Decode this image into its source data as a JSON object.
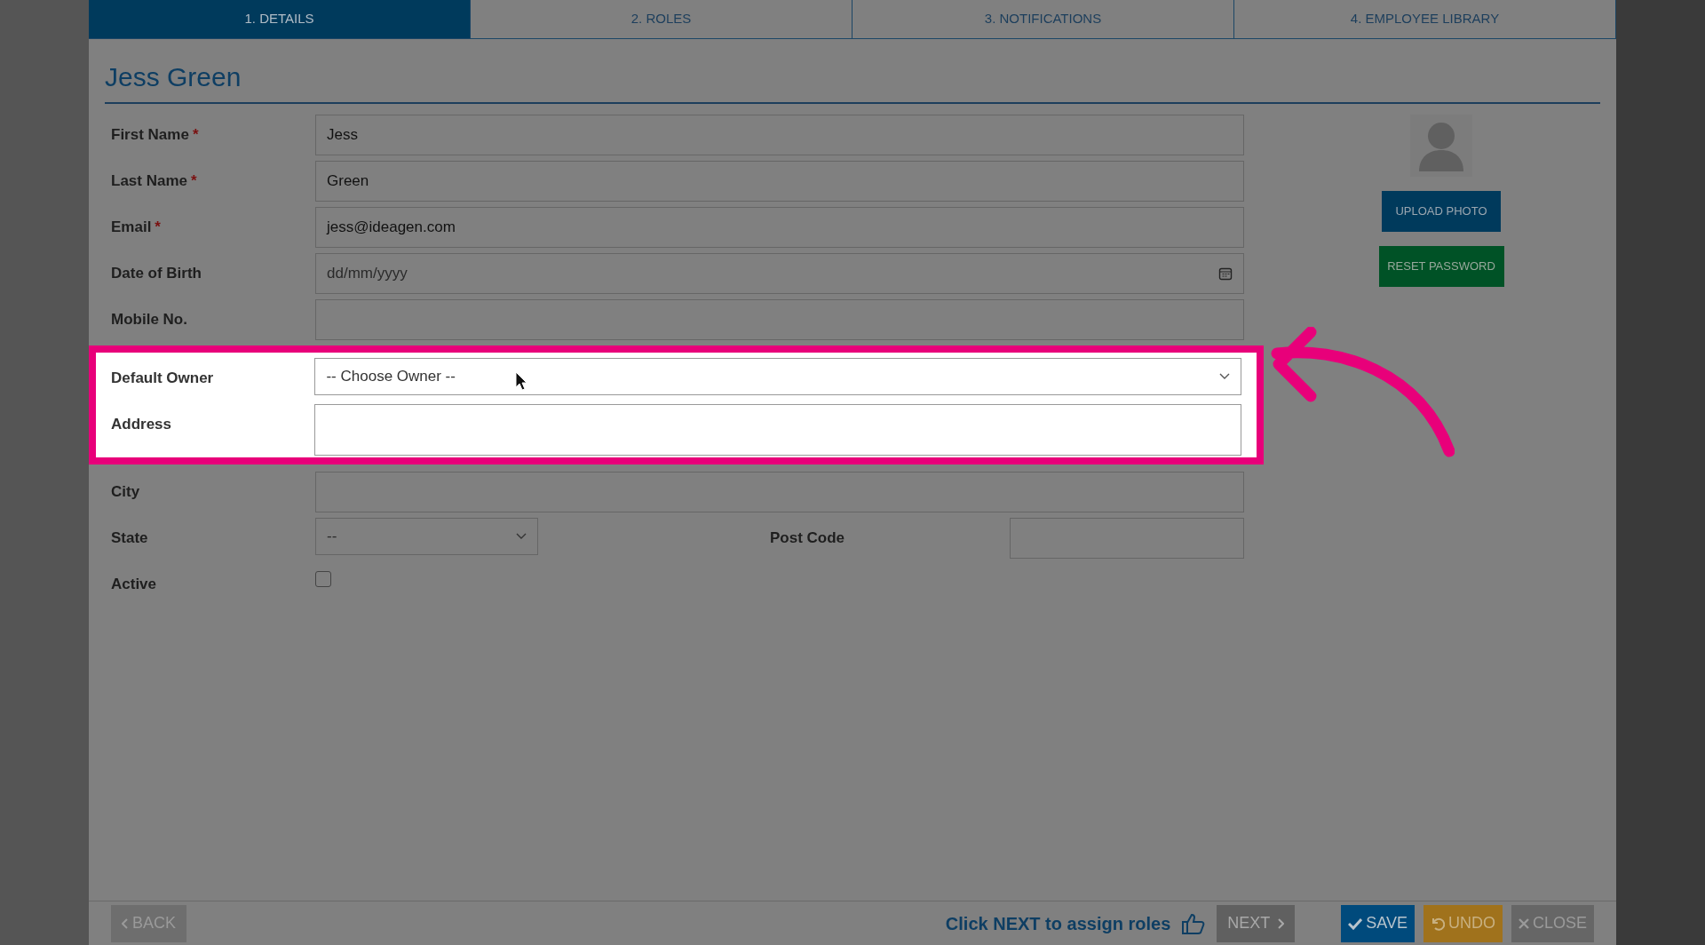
{
  "tabs": [
    {
      "label": "1. DETAILS",
      "selected": true
    },
    {
      "label": "2. ROLES",
      "selected": false
    },
    {
      "label": "3. NOTIFICATIONS",
      "selected": false
    },
    {
      "label": "4. EMPLOYEE LIBRARY",
      "selected": false
    }
  ],
  "title": "Jess Green",
  "fields": [
    {
      "kind": "text",
      "label": "First Name",
      "required_mark": "*",
      "value": "Jess",
      "highlighted": false
    },
    {
      "kind": "text",
      "label": "Last Name",
      "required_mark": "*",
      "value": "Green",
      "highlighted": false
    },
    {
      "kind": "text",
      "label": "Email",
      "required_mark": "*",
      "value": "jess@ideagen.com",
      "highlighted": false
    },
    {
      "kind": "date",
      "label": "Date of Birth",
      "placeholder": "dd/mm/yyyy",
      "highlighted": false
    },
    {
      "kind": "text",
      "label": "Mobile No.",
      "highlighted": false
    },
    {
      "kind": "select",
      "label": "Default Owner",
      "value": "-- Choose Owner --",
      "highlighted": true
    },
    {
      "kind": "textarea",
      "label": "Address",
      "highlighted": true
    },
    {
      "kind": "text",
      "label": "City",
      "highlighted": false
    }
  ],
  "state": {
    "label": "State",
    "value": "--"
  },
  "post_code": {
    "label": "Post Code"
  },
  "active": {
    "label": "Active",
    "checked": false
  },
  "side_buttons": [
    {
      "kind": "upload",
      "label": "UPLOAD PHOTO"
    },
    {
      "kind": "reset",
      "label": "RESET PASSWORD"
    }
  ],
  "footer": {
    "back": "BACK",
    "hint": "Click NEXT to assign roles",
    "next": "NEXT",
    "actions": [
      {
        "kind": "save",
        "label": "SAVE"
      },
      {
        "kind": "undo",
        "label": "UNDO"
      },
      {
        "kind": "close",
        "label": "CLOSE"
      }
    ]
  }
}
